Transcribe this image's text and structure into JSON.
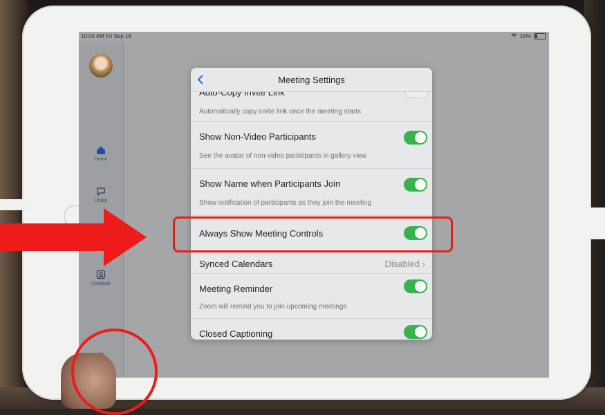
{
  "status_bar": {
    "time": "10:04 AM",
    "date": "Fri Sep 18",
    "battery": "16%"
  },
  "sidebar": {
    "items": [
      {
        "label": "Home",
        "icon": "home-icon"
      },
      {
        "label": "Chats",
        "icon": "chat-icon"
      },
      {
        "label": "Contacts",
        "icon": "contacts-icon"
      },
      {
        "label": "Settings",
        "icon": "gear-icon"
      }
    ]
  },
  "modal": {
    "title": "Meeting Settings",
    "partial_label": "Auto-Copy Invite Link",
    "rows": [
      {
        "label": "",
        "description": "Automatically copy invite link once the meeting starts",
        "on": false
      },
      {
        "label": "Show Non-Video Participants",
        "description": "See the avatar of non-video participants in gallery view",
        "on": true
      },
      {
        "label": "Show Name when Participants Join",
        "description": "Show notification of participants as they join the meeting",
        "on": true
      },
      {
        "label": "Always Show Meeting Controls",
        "description": "",
        "on": true
      },
      {
        "label": "Synced Calendars",
        "value": "Disabled"
      },
      {
        "label": "Meeting Reminder",
        "description": "Zoom will remind you to join upcoming meetings",
        "on": true
      },
      {
        "label": "Closed Captioning",
        "description": "",
        "on": true
      }
    ]
  },
  "colors": {
    "toggle_on": "#37b24d",
    "annotation": "#ee1b1b",
    "accent": "#2b6cd8"
  }
}
